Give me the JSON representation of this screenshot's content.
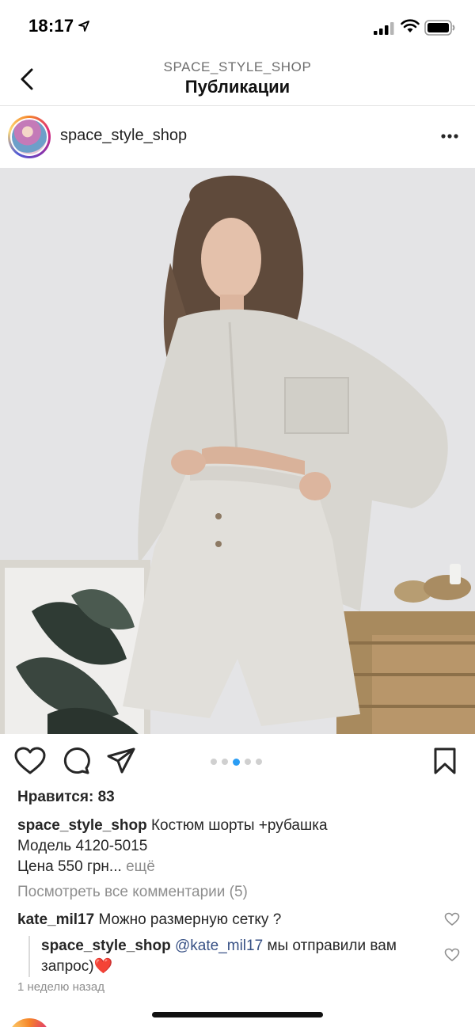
{
  "status_bar": {
    "time": "18:17"
  },
  "header": {
    "subtitle": "SPACE_STYLE_SHOP",
    "title": "Публикации"
  },
  "post": {
    "username": "space_style_shop",
    "carousel": {
      "count": 5,
      "active_index": 2
    },
    "likes_label": "Нравится: 83",
    "caption": {
      "user": "space_style_shop",
      "line1": "Костюм шорты +рубашка",
      "line2": "Модель 4120-5015",
      "line3": "Цена 550 грн...",
      "more": "ещё"
    },
    "view_comments": "Посмотреть все комментарии (5)",
    "comments": [
      {
        "user": "kate_mil17",
        "text": "Можно размерную сетку ?"
      }
    ],
    "reply": {
      "user": "space_style_shop",
      "mention": "@kate_mil17",
      "text_line1": "мы отправили вам",
      "text_line2": "запрос)",
      "emoji": "❤️"
    },
    "timestamp": "1 неделю назад"
  },
  "colors": {
    "accent_dot": "#2a9df4",
    "mention": "#385185",
    "muted_text": "#8e8e8e"
  },
  "icons": {
    "back": "chevron-left-icon",
    "more": "more-horizontal-icon",
    "like": "heart-icon",
    "comment": "comment-bubble-icon",
    "share": "paper-plane-icon",
    "save": "bookmark-icon"
  }
}
